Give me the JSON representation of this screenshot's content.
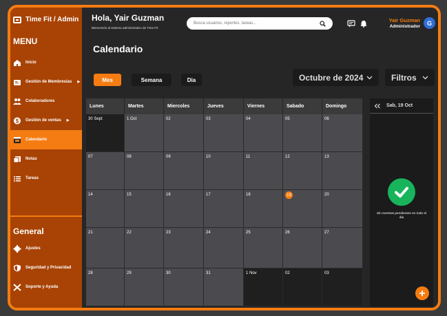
{
  "brand": {
    "title": "Time Fit / Admin",
    "icon": "dumbbell-icon"
  },
  "sidebar": {
    "menu_title": "MENU",
    "items": [
      {
        "label": "Inicio",
        "icon": "home-icon"
      },
      {
        "label": "Gestión de Membresías",
        "icon": "membership-icon",
        "arrow": "▶"
      },
      {
        "label": "Colaboradores",
        "icon": "users-icon"
      },
      {
        "label": "Gestión de ventas",
        "icon": "dollar-icon",
        "arrow": "▶"
      },
      {
        "label": "Calendario",
        "icon": "calendar-icon",
        "active": true
      },
      {
        "label": "Notas",
        "icon": "notes-icon"
      },
      {
        "label": "Tareas",
        "icon": "tasks-icon"
      }
    ],
    "general_title": "General",
    "general_items": [
      {
        "label": "Ajustes",
        "icon": "gear-icon"
      },
      {
        "label": "Seguridad y Privacidad",
        "icon": "shield-icon"
      },
      {
        "label": "Soporte y Ayuda",
        "icon": "tools-icon"
      }
    ]
  },
  "header": {
    "greeting": "Hola, Yair Guzman",
    "subtitle": "Bienvenido al sistema administrativo de Time Fit",
    "search_placeholder": "Busca usuarios, reportes, tareas...",
    "user_name": "Yair Guzman",
    "user_role": "Administrador",
    "avatar_initial": "G"
  },
  "page": {
    "title": "Calendario",
    "views": [
      {
        "label": "Mes",
        "active": true
      },
      {
        "label": "Semana"
      },
      {
        "label": "Dia"
      }
    ],
    "month_label": "Octubre de 2024",
    "filters_label": "Filtros"
  },
  "calendar": {
    "weekdays": [
      "Lunes",
      "Martes",
      "Miercoles",
      "Jueves",
      "Viernes",
      "Sabado",
      "Domingo"
    ],
    "weeks": [
      [
        "30 Sept",
        "1 Oct",
        "02",
        "03",
        "04",
        "05",
        "06"
      ],
      [
        "07",
        "08",
        "09",
        "10",
        "11",
        "12",
        "13"
      ],
      [
        "14",
        "15",
        "16",
        "17",
        "18",
        "19",
        "20"
      ],
      [
        "21",
        "22",
        "23",
        "24",
        "25",
        "26",
        "27"
      ],
      [
        "28",
        "29",
        "30",
        "31",
        "1 Nov",
        "02",
        "03"
      ]
    ],
    "today": "19"
  },
  "side_panel": {
    "date": "Sab, 19 Oct",
    "message": "Sin eventos pendientes en todo el dia"
  },
  "colors": {
    "accent": "#f57c12",
    "sidebar": "#a84305",
    "success": "#18b45c"
  }
}
